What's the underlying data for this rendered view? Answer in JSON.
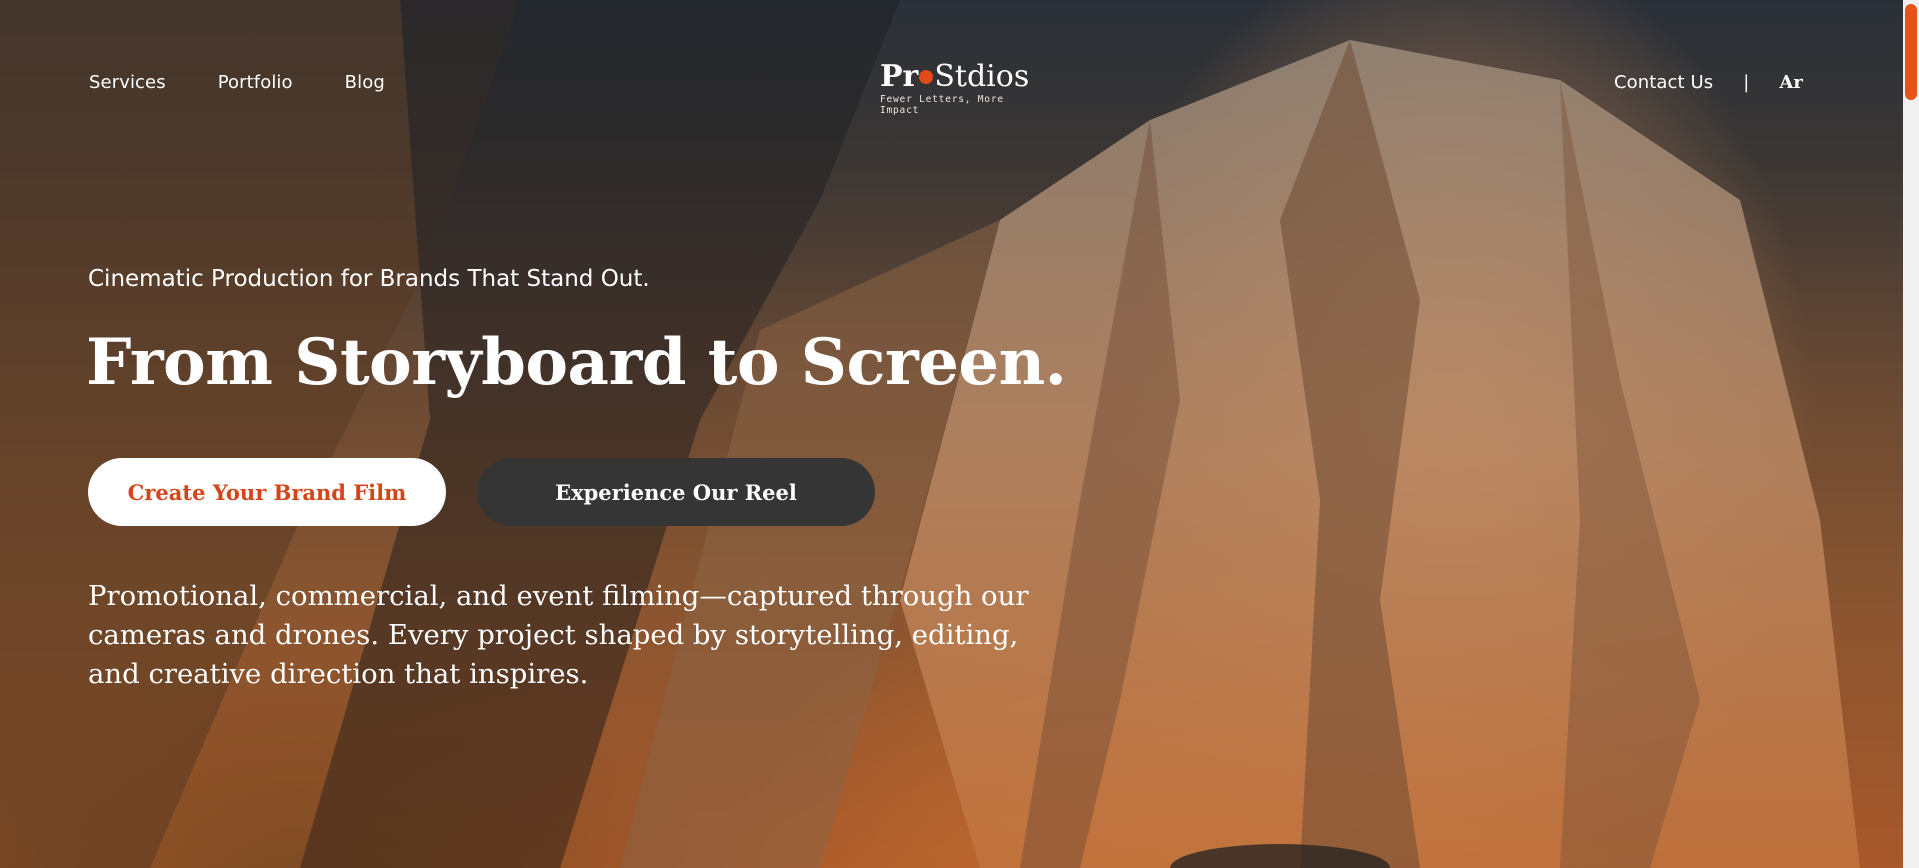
{
  "nav": {
    "left": [
      {
        "label": "Services"
      },
      {
        "label": "Portfolio"
      },
      {
        "label": "Blog"
      }
    ],
    "contact_label": "Contact Us",
    "separator": "|",
    "language_label": "Ar"
  },
  "logo": {
    "word_start": "Pr",
    "word_end": "Stdios",
    "tagline": "Fewer Letters, More Impact"
  },
  "hero": {
    "subheading": "Cinematic Production for Brands That Stand Out.",
    "headline": "From Storyboard to Screen.",
    "primary_button": "Create Your Brand Film",
    "secondary_button": "Experience Our Reel",
    "description": "Promotional, commercial, and event filming—captured through our cameras and drones. Every project shaped by storytelling, editing, and creative direction that inspires."
  },
  "colors": {
    "accent": "#e24a1a",
    "button_dark": "#363536",
    "scrollbar_thumb": "#e4531c"
  }
}
